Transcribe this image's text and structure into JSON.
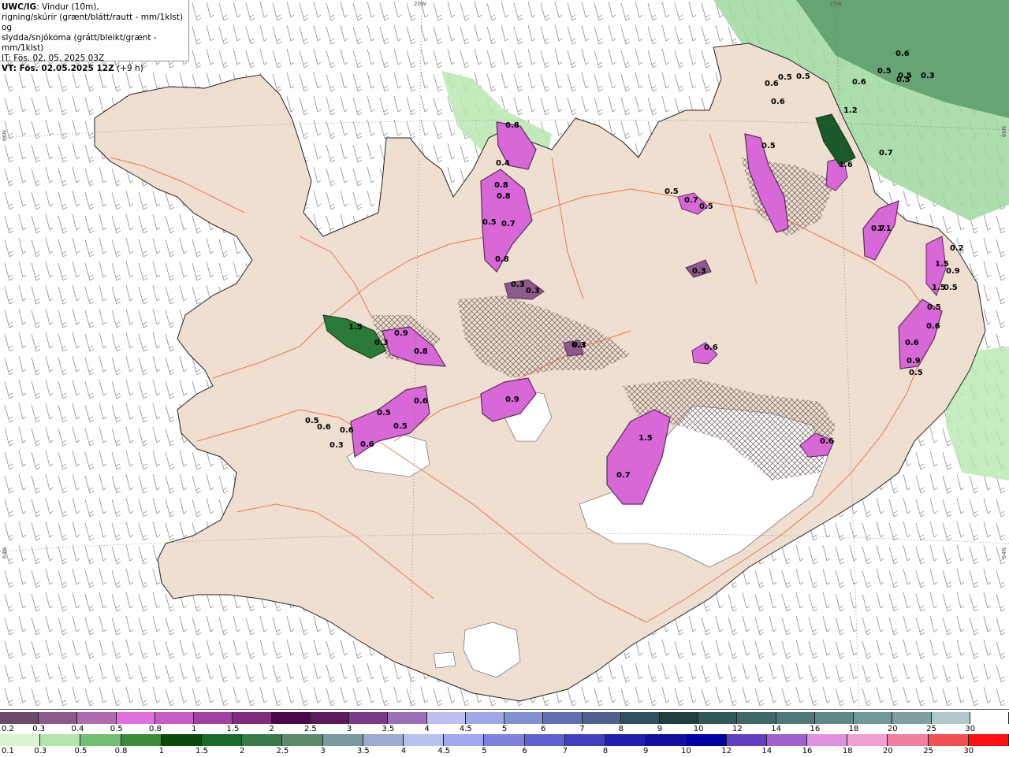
{
  "header": {
    "model": "UWC/IG",
    "line1_rest": ": Vindur (10m),",
    "line2": "rigning/skúrir (grænt/blátt/rautt - mm/1klst) og",
    "line3": "slydda/snjókoma (grátt/bleikt/grænt - mm/1klst)",
    "line4": "IT: Fös. 02. 05. 2025 03Z",
    "line5_bold": "VT: Fös. 02.05.2025 12Z",
    "line5_rest": " (+9 h)"
  },
  "coords": {
    "top_20w": "20W",
    "top_15w": "15W",
    "left_66n": "66N",
    "right_66n": "66N",
    "left_64n": "64N",
    "right_64n": "64N"
  },
  "precip_labels": [
    {
      "text": "1.5"
    },
    {
      "text": "0.8"
    },
    {
      "text": "0.4"
    },
    {
      "text": "0.8"
    },
    {
      "text": "0.8"
    },
    {
      "text": "0.5"
    },
    {
      "text": "0.7"
    },
    {
      "text": "0.8"
    },
    {
      "text": "0.3"
    },
    {
      "text": "0.3"
    },
    {
      "text": "0.5"
    },
    {
      "text": "0.7"
    },
    {
      "text": "0.5"
    },
    {
      "text": "0.3"
    },
    {
      "text": "0.3"
    },
    {
      "text": "0.5"
    },
    {
      "text": "0.3"
    },
    {
      "text": "0.5"
    },
    {
      "text": "0.6"
    },
    {
      "text": "0.6"
    },
    {
      "text": "0.5"
    },
    {
      "text": "0.6"
    },
    {
      "text": "0.5"
    },
    {
      "text": "0.6"
    },
    {
      "text": "0.5"
    },
    {
      "text": "0.5"
    },
    {
      "text": "0.7"
    },
    {
      "text": "1.2"
    },
    {
      "text": "1.6"
    },
    {
      "text": "0.7"
    },
    {
      "text": "1.1"
    },
    {
      "text": "0.2"
    },
    {
      "text": "1.5"
    },
    {
      "text": "0.9"
    },
    {
      "text": "0.5"
    },
    {
      "text": "0.5"
    },
    {
      "text": "0.6"
    },
    {
      "text": "0.6"
    },
    {
      "text": "0.9"
    },
    {
      "text": "0.5"
    },
    {
      "text": "1.5"
    },
    {
      "text": "0.3"
    },
    {
      "text": "0.9"
    },
    {
      "text": "0.8"
    },
    {
      "text": "0.3"
    },
    {
      "text": "0.6"
    },
    {
      "text": "0.9"
    },
    {
      "text": "1.5"
    },
    {
      "text": "0.7"
    },
    {
      "text": "0.6"
    },
    {
      "text": "0.5"
    },
    {
      "text": "0.6"
    },
    {
      "text": "0.6"
    },
    {
      "text": "0.5"
    },
    {
      "text": "0.5"
    },
    {
      "text": "0.6"
    },
    {
      "text": "0.6"
    },
    {
      "text": "0.3"
    }
  ],
  "scale_snow": {
    "labels": [
      "0.2",
      "0.3",
      "0.4",
      "0.5",
      "0.8",
      "1",
      "1.5",
      "2",
      "2.5",
      "3",
      "3.5",
      "4",
      "4.5",
      "5",
      "6",
      "7",
      "8",
      "9",
      "10",
      "12",
      "14",
      "16",
      "18",
      "20",
      "25",
      "30"
    ],
    "colors": [
      "#6b4a6b",
      "#8a5a8a",
      "#b06ab0",
      "#e070e0",
      "#c85cc8",
      "#a040a0",
      "#802c80",
      "#4a0a4a",
      "#5c1a5c",
      "#7a3a8a",
      "#9a70b8",
      "#c0c0f0",
      "#a0a8e8",
      "#8090d0",
      "#6070b0",
      "#506090",
      "#305060",
      "#204040",
      "#305858",
      "#406868",
      "#507878",
      "#608888",
      "#709898",
      "#80a0a0",
      "#b0c8c8",
      "#ffffff"
    ]
  },
  "scale_rain": {
    "labels": [
      "0.1",
      "0.3",
      "0.5",
      "0.8",
      "1",
      "1.5",
      "2",
      "2.5",
      "3",
      "3.5",
      "4",
      "4.5",
      "5",
      "6",
      "7",
      "8",
      "9",
      "10",
      "12",
      "14",
      "16",
      "18",
      "20",
      "25",
      "30"
    ],
    "colors": [
      "#d8f5d0",
      "#b0e8a8",
      "#70c070",
      "#3a8a3a",
      "#0a4a0a",
      "#1a6a2a",
      "#3a7a4a",
      "#5a8a6a",
      "#7a9aa0",
      "#9aaad0",
      "#b8c0f0",
      "#a0a8f0",
      "#8080e0",
      "#6060d0",
      "#4040c0",
      "#2020b0",
      "#1010a0",
      "#0000a0",
      "#6040c0",
      "#a060d0",
      "#e090e0",
      "#f0a0d0",
      "#f080a0",
      "#f05050",
      "#ff1010"
    ]
  }
}
